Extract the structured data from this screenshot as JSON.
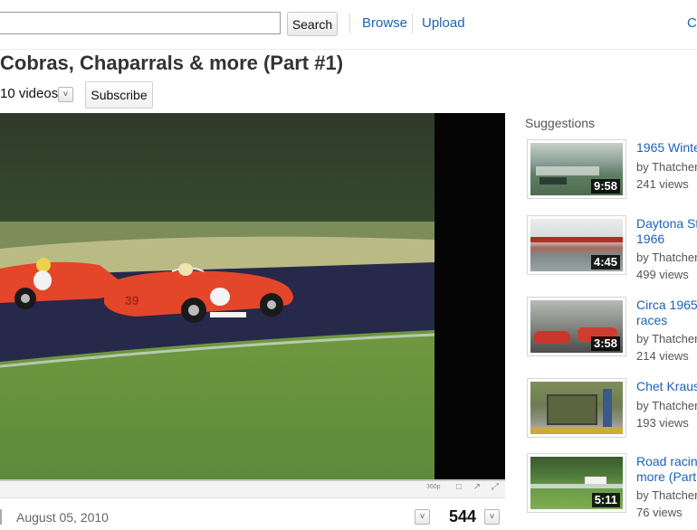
{
  "header": {
    "search_placeholder": "",
    "search_button": "Search",
    "nav": [
      "Browse",
      "Upload",
      "Cr"
    ]
  },
  "playlist": {
    "title": "Cobras, Chaparrals & more (Part #1)",
    "video_count": "10 videos",
    "subscribe_label": "Subscribe"
  },
  "player": {
    "quality": "360p",
    "progress": 0
  },
  "meta": {
    "date": "August 05, 2010",
    "views": "544"
  },
  "suggestions": {
    "header": "Suggestions",
    "items": [
      {
        "title_lines": [
          "1965 Winte"
        ],
        "by": "by Thatcher",
        "views": "241 views",
        "duration": "9:58"
      },
      {
        "title_lines": [
          "Daytona Sto",
          "1966"
        ],
        "by": "by Thatcher",
        "views": "499 views",
        "duration": "4:45"
      },
      {
        "title_lines": [
          "Circa 1965",
          "races"
        ],
        "by": "by Thatcher",
        "views": "214 views",
        "duration": "3:58"
      },
      {
        "title_lines": [
          "Chet Kraus"
        ],
        "by": "by Thatcher",
        "views": "193 views",
        "duration": ""
      },
      {
        "title_lines": [
          "Road racing",
          "more (Part"
        ],
        "by": "by Thatcher",
        "views": "76 views",
        "duration": "5:11"
      }
    ]
  },
  "colors": {
    "link": "#1c62b9",
    "car_red": "#e4462a",
    "track_grass": "#5d8a3a"
  },
  "icons": [
    "toggle-arrow-icon",
    "window-icon",
    "expand-icon",
    "fullscreen-icon"
  ]
}
